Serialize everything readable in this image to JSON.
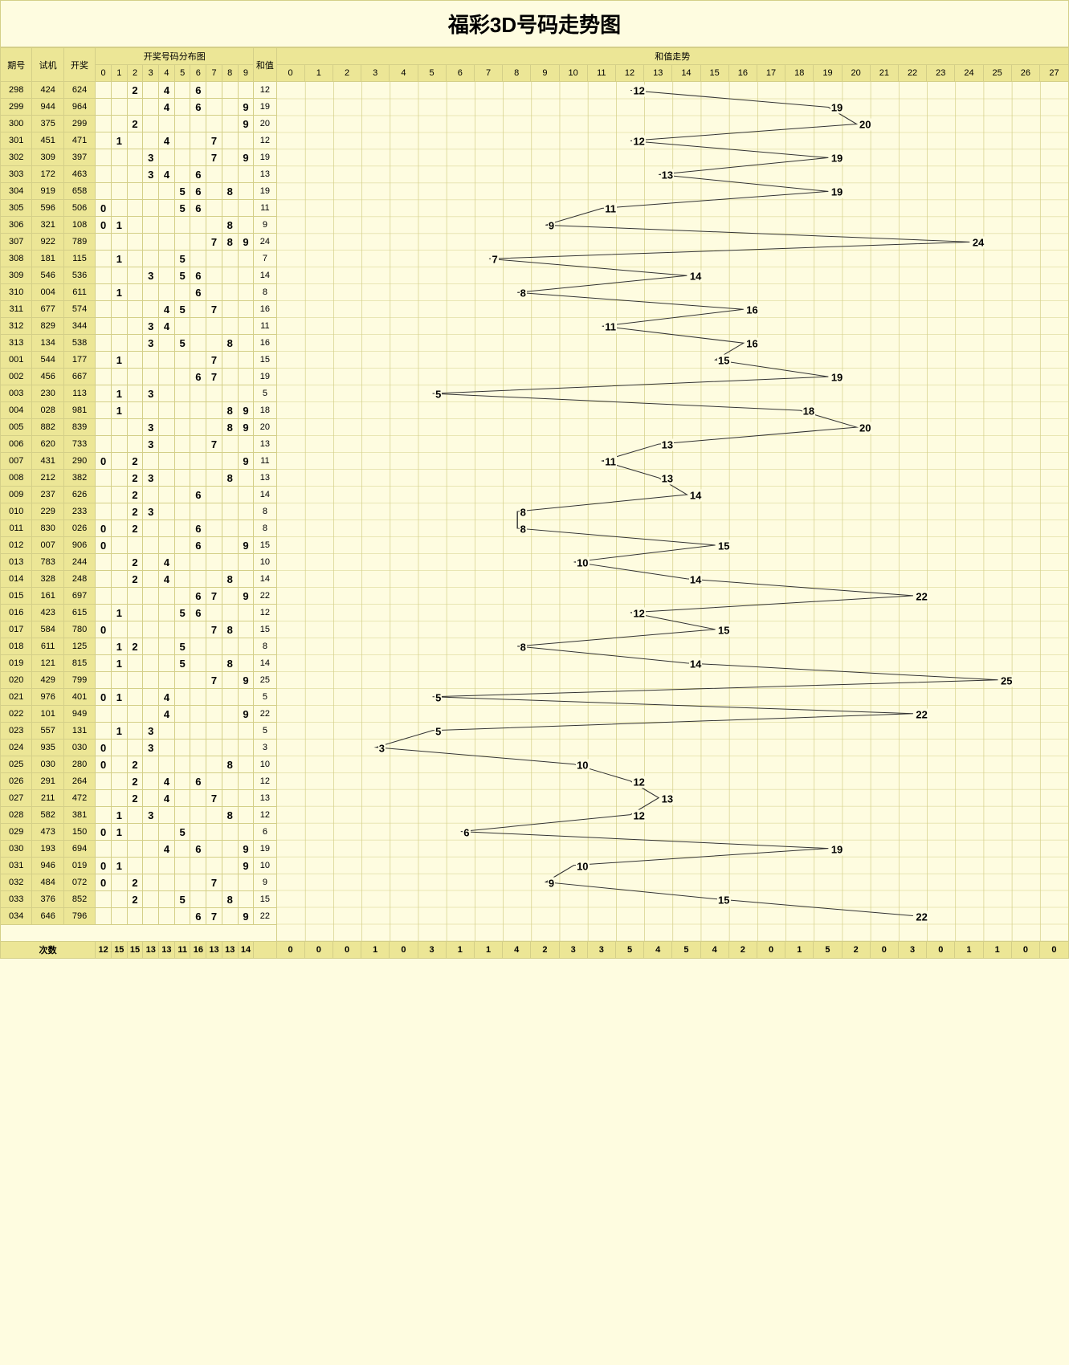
{
  "title": "福彩3D号码走势图",
  "headers": {
    "period": "期号",
    "trial": "试机",
    "draw": "开奖",
    "dist": "开奖号码分布图",
    "sum": "和值",
    "trend": "和值走势",
    "count": "次数"
  },
  "digit_cols": [
    0,
    1,
    2,
    3,
    4,
    5,
    6,
    7,
    8,
    9
  ],
  "trend_cols": [
    0,
    1,
    2,
    3,
    4,
    5,
    6,
    7,
    8,
    9,
    10,
    11,
    12,
    13,
    14,
    15,
    16,
    17,
    18,
    19,
    20,
    21,
    22,
    23,
    24,
    25,
    26,
    27
  ],
  "rows": [
    {
      "period": "298",
      "trial": "424",
      "draw": "624",
      "digits": [
        2,
        4,
        6
      ],
      "sum": 12
    },
    {
      "period": "299",
      "trial": "944",
      "draw": "964",
      "digits": [
        4,
        6,
        9
      ],
      "sum": 19
    },
    {
      "period": "300",
      "trial": "375",
      "draw": "299",
      "digits": [
        2,
        9
      ],
      "sum": 20
    },
    {
      "period": "301",
      "trial": "451",
      "draw": "471",
      "digits": [
        1,
        4,
        7
      ],
      "sum": 12
    },
    {
      "period": "302",
      "trial": "309",
      "draw": "397",
      "digits": [
        3,
        7,
        9
      ],
      "sum": 19
    },
    {
      "period": "303",
      "trial": "172",
      "draw": "463",
      "digits": [
        3,
        4,
        6
      ],
      "sum": 13
    },
    {
      "period": "304",
      "trial": "919",
      "draw": "658",
      "digits": [
        5,
        6,
        8
      ],
      "sum": 19
    },
    {
      "period": "305",
      "trial": "596",
      "draw": "506",
      "digits": [
        0,
        5,
        6
      ],
      "sum": 11
    },
    {
      "period": "306",
      "trial": "321",
      "draw": "108",
      "digits": [
        0,
        1,
        8
      ],
      "sum": 9
    },
    {
      "period": "307",
      "trial": "922",
      "draw": "789",
      "digits": [
        7,
        8,
        9
      ],
      "sum": 24
    },
    {
      "period": "308",
      "trial": "181",
      "draw": "115",
      "digits": [
        1,
        5
      ],
      "sum": 7
    },
    {
      "period": "309",
      "trial": "546",
      "draw": "536",
      "digits": [
        3,
        5,
        6
      ],
      "sum": 14
    },
    {
      "period": "310",
      "trial": "004",
      "draw": "611",
      "digits": [
        1,
        6
      ],
      "sum": 8
    },
    {
      "period": "311",
      "trial": "677",
      "draw": "574",
      "digits": [
        4,
        5,
        7
      ],
      "sum": 16
    },
    {
      "period": "312",
      "trial": "829",
      "draw": "344",
      "digits": [
        3,
        4
      ],
      "sum": 11
    },
    {
      "period": "313",
      "trial": "134",
      "draw": "538",
      "digits": [
        3,
        5,
        8
      ],
      "sum": 16
    },
    {
      "period": "001",
      "trial": "544",
      "draw": "177",
      "digits": [
        1,
        7
      ],
      "sum": 15
    },
    {
      "period": "002",
      "trial": "456",
      "draw": "667",
      "digits": [
        6,
        7
      ],
      "sum": 19
    },
    {
      "period": "003",
      "trial": "230",
      "draw": "113",
      "digits": [
        1,
        3
      ],
      "sum": 5
    },
    {
      "period": "004",
      "trial": "028",
      "draw": "981",
      "digits": [
        1,
        8,
        9
      ],
      "sum": 18
    },
    {
      "period": "005",
      "trial": "882",
      "draw": "839",
      "digits": [
        3,
        8,
        9
      ],
      "sum": 20
    },
    {
      "period": "006",
      "trial": "620",
      "draw": "733",
      "digits": [
        3,
        7
      ],
      "sum": 13
    },
    {
      "period": "007",
      "trial": "431",
      "draw": "290",
      "digits": [
        0,
        2,
        9
      ],
      "sum": 11
    },
    {
      "period": "008",
      "trial": "212",
      "draw": "382",
      "digits": [
        2,
        3,
        8
      ],
      "sum": 13
    },
    {
      "period": "009",
      "trial": "237",
      "draw": "626",
      "digits": [
        2,
        6
      ],
      "sum": 14
    },
    {
      "period": "010",
      "trial": "229",
      "draw": "233",
      "digits": [
        2,
        3
      ],
      "sum": 8
    },
    {
      "period": "011",
      "trial": "830",
      "draw": "026",
      "digits": [
        0,
        2,
        6
      ],
      "sum": 8
    },
    {
      "period": "012",
      "trial": "007",
      "draw": "906",
      "digits": [
        0,
        6,
        9
      ],
      "sum": 15
    },
    {
      "period": "013",
      "trial": "783",
      "draw": "244",
      "digits": [
        2,
        4
      ],
      "sum": 10
    },
    {
      "period": "014",
      "trial": "328",
      "draw": "248",
      "digits": [
        2,
        4,
        8
      ],
      "sum": 14
    },
    {
      "period": "015",
      "trial": "161",
      "draw": "697",
      "digits": [
        6,
        7,
        9
      ],
      "sum": 22
    },
    {
      "period": "016",
      "trial": "423",
      "draw": "615",
      "digits": [
        1,
        5,
        6
      ],
      "sum": 12
    },
    {
      "period": "017",
      "trial": "584",
      "draw": "780",
      "digits": [
        0,
        7,
        8
      ],
      "sum": 15
    },
    {
      "period": "018",
      "trial": "611",
      "draw": "125",
      "digits": [
        1,
        2,
        5
      ],
      "sum": 8
    },
    {
      "period": "019",
      "trial": "121",
      "draw": "815",
      "digits": [
        1,
        5,
        8
      ],
      "sum": 14
    },
    {
      "period": "020",
      "trial": "429",
      "draw": "799",
      "digits": [
        7,
        9
      ],
      "sum": 25
    },
    {
      "period": "021",
      "trial": "976",
      "draw": "401",
      "digits": [
        0,
        1,
        4
      ],
      "sum": 5
    },
    {
      "period": "022",
      "trial": "101",
      "draw": "949",
      "digits": [
        4,
        9
      ],
      "sum": 22
    },
    {
      "period": "023",
      "trial": "557",
      "draw": "131",
      "digits": [
        1,
        3
      ],
      "sum": 5
    },
    {
      "period": "024",
      "trial": "935",
      "draw": "030",
      "digits": [
        0,
        3
      ],
      "sum": 3
    },
    {
      "period": "025",
      "trial": "030",
      "draw": "280",
      "digits": [
        0,
        2,
        8
      ],
      "sum": 10
    },
    {
      "period": "026",
      "trial": "291",
      "draw": "264",
      "digits": [
        2,
        4,
        6
      ],
      "sum": 12
    },
    {
      "period": "027",
      "trial": "211",
      "draw": "472",
      "digits": [
        2,
        4,
        7
      ],
      "sum": 13
    },
    {
      "period": "028",
      "trial": "582",
      "draw": "381",
      "digits": [
        1,
        3,
        8
      ],
      "sum": 12
    },
    {
      "period": "029",
      "trial": "473",
      "draw": "150",
      "digits": [
        0,
        1,
        5
      ],
      "sum": 6
    },
    {
      "period": "030",
      "trial": "193",
      "draw": "694",
      "digits": [
        4,
        6,
        9
      ],
      "sum": 19
    },
    {
      "period": "031",
      "trial": "946",
      "draw": "019",
      "digits": [
        0,
        1,
        9
      ],
      "sum": 10
    },
    {
      "period": "032",
      "trial": "484",
      "draw": "072",
      "digits": [
        0,
        2,
        7
      ],
      "sum": 9
    },
    {
      "period": "033",
      "trial": "376",
      "draw": "852",
      "digits": [
        2,
        5,
        8
      ],
      "sum": 15
    },
    {
      "period": "034",
      "trial": "646",
      "draw": "796",
      "digits": [
        6,
        7,
        9
      ],
      "sum": 22
    }
  ],
  "digit_counts": [
    12,
    15,
    15,
    13,
    13,
    11,
    16,
    13,
    13,
    14
  ],
  "trend_counts": [
    0,
    0,
    0,
    1,
    0,
    3,
    1,
    1,
    4,
    2,
    3,
    3,
    5,
    4,
    5,
    4,
    2,
    0,
    1,
    5,
    2,
    0,
    3,
    0,
    1,
    1,
    0,
    0
  ],
  "chart_data": {
    "type": "line",
    "title": "和值走势",
    "xlabel": "期号",
    "ylabel": "和值",
    "x": [
      "298",
      "299",
      "300",
      "301",
      "302",
      "303",
      "304",
      "305",
      "306",
      "307",
      "308",
      "309",
      "310",
      "311",
      "312",
      "313",
      "001",
      "002",
      "003",
      "004",
      "005",
      "006",
      "007",
      "008",
      "009",
      "010",
      "011",
      "012",
      "013",
      "014",
      "015",
      "016",
      "017",
      "018",
      "019",
      "020",
      "021",
      "022",
      "023",
      "024",
      "025",
      "026",
      "027",
      "028",
      "029",
      "030",
      "031",
      "032",
      "033",
      "034"
    ],
    "values": [
      12,
      19,
      20,
      12,
      19,
      13,
      19,
      11,
      9,
      24,
      7,
      14,
      8,
      16,
      11,
      16,
      15,
      19,
      5,
      18,
      20,
      13,
      11,
      13,
      14,
      8,
      8,
      15,
      10,
      14,
      22,
      12,
      15,
      8,
      14,
      25,
      5,
      22,
      5,
      3,
      10,
      12,
      13,
      12,
      6,
      19,
      10,
      9,
      15,
      22
    ],
    "ylim": [
      0,
      27
    ]
  }
}
